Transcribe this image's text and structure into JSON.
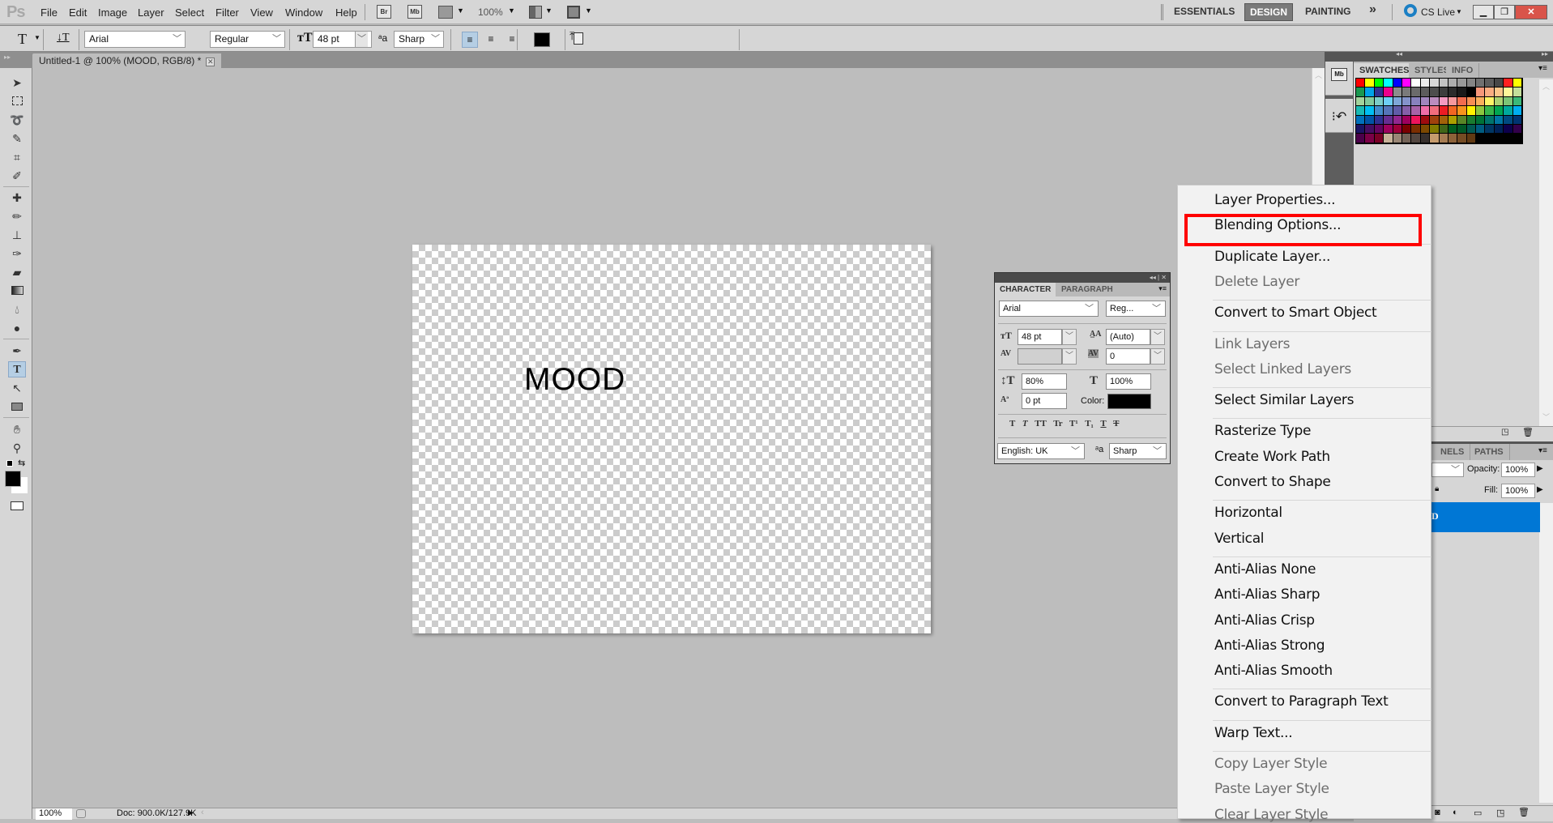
{
  "app": {
    "logo": "Ps"
  },
  "menubar": {
    "items": [
      "File",
      "Edit",
      "Image",
      "Layer",
      "Select",
      "Filter",
      "View",
      "Window",
      "Help"
    ],
    "bridge_label": "Br",
    "minibridge_label": "Mb",
    "zoom_value": "100%",
    "workspaces": [
      "ESSENTIALS",
      "DESIGN",
      "PAINTING"
    ],
    "active_workspace": "DESIGN",
    "more_label": "»",
    "cslive_label": "CS Live"
  },
  "options_bar": {
    "tool_glyph": "T",
    "font_family": "Arial",
    "font_style": "Regular",
    "font_size": "48 pt",
    "antialias": "Sharp",
    "text_color": "#000000"
  },
  "document": {
    "tab_title": "Untitled-1 @ 100% (MOOD, RGB/8) *",
    "canvas_text": "MOOD"
  },
  "status_bar": {
    "zoom": "100%",
    "doc_info": "Doc: 900.0K/127.9K"
  },
  "toolbox": {
    "tools": [
      "move",
      "marquee",
      "lasso",
      "quick-selection",
      "crop",
      "eyedropper",
      "spot-healing",
      "brush",
      "clone-stamp",
      "history-brush",
      "eraser",
      "gradient",
      "blur",
      "dodge",
      "pen",
      "type",
      "path-selection",
      "rectangle",
      "hand",
      "zoom"
    ],
    "active_tool": "type",
    "foreground": "#000000",
    "background": "#ffffff"
  },
  "swatches_panel": {
    "tabs": [
      "SWATCHES",
      "STYLES",
      "INFO"
    ],
    "active_tab": "SWATCHES",
    "colors": [
      "#ff0000",
      "#ffff00",
      "#00ff00",
      "#00ffff",
      "#0000ff",
      "#ff00ff",
      "#ffffff",
      "#ebebeb",
      "#d6d6d6",
      "#c2c2c2",
      "#adadad",
      "#999999",
      "#858585",
      "#707070",
      "#5c5c5c",
      "#474747",
      "#ff2020",
      "#ffff00",
      "#1a9850",
      "#00a2e8",
      "#2e3192",
      "#ec008c",
      "#8c8c8c",
      "#7a7a7a",
      "#6b6b6b",
      "#5c5c5c",
      "#4d4d4d",
      "#3d3d3d",
      "#2b2b2b",
      "#1a1a1a",
      "#000000",
      "#f7977a",
      "#fbad82",
      "#fdc68a",
      "#fff79a",
      "#c4df9b",
      "#a3d39c",
      "#82ca9d",
      "#7bcdc8",
      "#6ecff6",
      "#7ea7d8",
      "#8493ca",
      "#8882be",
      "#a187be",
      "#bc8dbf",
      "#f49ac2",
      "#f6989d",
      "#f26c4f",
      "#f68e55",
      "#fbaf5c",
      "#fff467",
      "#acd372",
      "#7cc576",
      "#3bb878",
      "#1abbb4",
      "#00bff3",
      "#438ccb",
      "#5574b9",
      "#605ca8",
      "#855fa8",
      "#a763a8",
      "#f06ea9",
      "#f26d7d",
      "#ed1c24",
      "#f26522",
      "#f7941d",
      "#fff200",
      "#8dc63f",
      "#39b54a",
      "#00a651",
      "#00a99d",
      "#00aeef",
      "#0072bc",
      "#0054a6",
      "#2e3192",
      "#662d91",
      "#92278f",
      "#9e005d",
      "#ed145b",
      "#9e0b0f",
      "#a0410d",
      "#a36209",
      "#aba000",
      "#598527",
      "#197b30",
      "#007236",
      "#00746b",
      "#0076a3",
      "#004a80",
      "#003471",
      "#1b1464",
      "#440e62",
      "#630460",
      "#9e005d",
      "#9e0039",
      "#790000",
      "#7b2e00",
      "#7d4900",
      "#827b00",
      "#406618",
      "#005e20",
      "#005826",
      "#005952",
      "#005b7f",
      "#003663",
      "#002157",
      "#0d004c",
      "#32004b",
      "#4b0049",
      "#7b0046",
      "#7a0026",
      "#c7b299",
      "#998675",
      "#736357",
      "#534741",
      "#37302d",
      "#c69c6d",
      "#a67c52",
      "#8c6239",
      "#754c24",
      "#603913"
    ]
  },
  "dock_icons": [
    "mini-bridge",
    "history"
  ],
  "character_panel": {
    "tabs": [
      "CHARACTER",
      "PARAGRAPH"
    ],
    "active_tab": "CHARACTER",
    "font_family": "Arial",
    "font_style": "Reg...",
    "font_size": "48 pt",
    "leading": "(Auto)",
    "kerning": "",
    "tracking": "0",
    "vertical_scale": "80%",
    "horizontal_scale": "100%",
    "baseline_shift": "0 pt",
    "color_label": "Color:",
    "color": "#000000",
    "style_buttons": [
      "T",
      "T",
      "TT",
      "Tr",
      "T¹",
      "T₁",
      "T",
      "T"
    ],
    "language": "English: UK",
    "antialias": "Sharp"
  },
  "layers_panel": {
    "tabs": [
      "NELS",
      "PATHS"
    ],
    "opacity_label": "Opacity:",
    "opacity": "100%",
    "fill_label": "Fill:",
    "fill": "100%",
    "selected_layer_fragment": "D",
    "selected_color": "#0077d5"
  },
  "context_menu": {
    "groups": [
      [
        {
          "label": "Layer Properties...",
          "enabled": true
        },
        {
          "label": "Blending Options...",
          "enabled": true,
          "highlighted": true
        }
      ],
      [
        {
          "label": "Duplicate Layer...",
          "enabled": true
        },
        {
          "label": "Delete Layer",
          "enabled": false
        }
      ],
      [
        {
          "label": "Convert to Smart Object",
          "enabled": true
        }
      ],
      [
        {
          "label": "Link Layers",
          "enabled": false
        },
        {
          "label": "Select Linked Layers",
          "enabled": false
        }
      ],
      [
        {
          "label": "Select Similar Layers",
          "enabled": true
        }
      ],
      [
        {
          "label": "Rasterize Type",
          "enabled": true
        },
        {
          "label": "Create Work Path",
          "enabled": true
        },
        {
          "label": "Convert to Shape",
          "enabled": true
        }
      ],
      [
        {
          "label": "Horizontal",
          "enabled": true
        },
        {
          "label": "Vertical",
          "enabled": true
        }
      ],
      [
        {
          "label": "Anti-Alias None",
          "enabled": true
        },
        {
          "label": "Anti-Alias Sharp",
          "enabled": true
        },
        {
          "label": "Anti-Alias Crisp",
          "enabled": true
        },
        {
          "label": "Anti-Alias Strong",
          "enabled": true
        },
        {
          "label": "Anti-Alias Smooth",
          "enabled": true
        }
      ],
      [
        {
          "label": "Convert to Paragraph Text",
          "enabled": true
        }
      ],
      [
        {
          "label": "Warp Text...",
          "enabled": true
        }
      ],
      [
        {
          "label": "Copy Layer Style",
          "enabled": false
        },
        {
          "label": "Paste Layer Style",
          "enabled": false
        },
        {
          "label": "Clear Layer Style",
          "enabled": false
        }
      ]
    ],
    "highlight_color": "#ff0000"
  }
}
